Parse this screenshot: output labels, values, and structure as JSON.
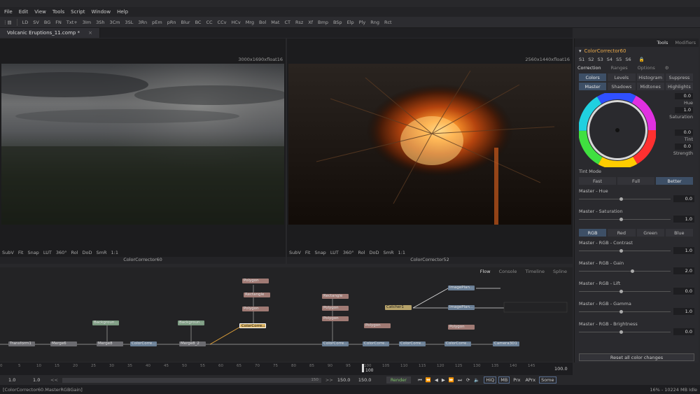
{
  "menu": [
    "File",
    "Edit",
    "View",
    "Tools",
    "Script",
    "Window",
    "Help"
  ],
  "toolbar": [
    "LD",
    "SV",
    "BG",
    "FN",
    "Txt+",
    "3Im",
    "3Sh",
    "3Cm",
    "3SL",
    "3Rn",
    "pEm",
    "pRn",
    "Blur",
    "BC",
    "CC",
    "CCv",
    "HCv",
    "Mrg",
    "Bol",
    "Mat",
    "CT",
    "Rsz",
    "Xf",
    "Bmp",
    "BSp",
    "Elp",
    "Ply",
    "Rng",
    "Rct"
  ],
  "tab": {
    "title": "Volcanic Eruptions_11.comp *",
    "close": "×"
  },
  "viewer_left": {
    "res": "3000x1690xfloat16",
    "label": "ColorCorrector60",
    "tools": [
      "SubV",
      "Fit",
      "Snap",
      "LUT",
      "360°",
      "Rol",
      "DoD",
      "SmR",
      "1:1"
    ]
  },
  "viewer_right": {
    "res": "2560x1440xfloat16",
    "label": "ColorCorrector52",
    "tools": [
      "SubV",
      "Fit",
      "Snap",
      "LUT",
      "360°",
      "Rol",
      "DoD",
      "SmR",
      "1:1"
    ]
  },
  "flow": {
    "tabs": [
      "Flow",
      "Console",
      "Timeline",
      "Spline"
    ],
    "nodes": [
      {
        "label": "Transform1",
        "cls": "n-g"
      },
      {
        "label": "Merge6",
        "cls": "n-g"
      },
      {
        "label": "Backgroun...",
        "cls": "n-grn"
      },
      {
        "label": "Merge8",
        "cls": "n-g"
      },
      {
        "label": "ColorCorre...",
        "cls": "n-b"
      },
      {
        "label": "Backgroun...",
        "cls": "n-grn"
      },
      {
        "label": "Merge8_2",
        "cls": "n-g"
      },
      {
        "label": "ColorCorre...",
        "cls": "n-sel"
      },
      {
        "label": "Polygon",
        "cls": "n-r"
      },
      {
        "label": "Rectangle",
        "cls": "n-r"
      },
      {
        "label": "Polygon",
        "cls": "n-r"
      },
      {
        "label": "Rectangle",
        "cls": "n-r"
      },
      {
        "label": "Polygon",
        "cls": "n-r"
      },
      {
        "label": "Polygon",
        "cls": "n-r"
      },
      {
        "label": "ColorCorre...",
        "cls": "n-b"
      },
      {
        "label": "Polygon",
        "cls": "n-r"
      },
      {
        "label": "ColorCorre...",
        "cls": "n-b"
      },
      {
        "label": "ColorCorre...",
        "cls": "n-b"
      },
      {
        "label": "Catcher1",
        "cls": "n-y"
      },
      {
        "label": "ImagePlan...",
        "cls": "n-b"
      },
      {
        "label": "ImagePlan...",
        "cls": "n-b"
      },
      {
        "label": "Polygon",
        "cls": "n-r"
      },
      {
        "label": "ColorCorre...",
        "cls": "n-b"
      },
      {
        "label": "Camera3D1",
        "cls": "n-b"
      }
    ]
  },
  "timeline": {
    "ticks": [
      "0",
      "5",
      "10",
      "15",
      "20",
      "25",
      "30",
      "35",
      "40",
      "45",
      "50",
      "55",
      "60",
      "65",
      "70",
      "75",
      "80",
      "85",
      "90",
      "95",
      "100",
      "105",
      "110",
      "115",
      "120",
      "125",
      "130",
      "135",
      "140",
      "145"
    ],
    "end_value": "100.0",
    "current": "100"
  },
  "transport": {
    "start": "1.0",
    "in": "1.0",
    "out": "150.0",
    "end": "150.0",
    "range_mark": "150",
    "render": "Render",
    "buttons": [
      "HiQ",
      "MB",
      "Prx",
      "APrx",
      "Some"
    ]
  },
  "status": {
    "left": "[ColorCorrector60.MasterRGBGain]",
    "right": "16% - 10224 MB   Idle"
  },
  "inspector": {
    "top_tabs": [
      "Tools",
      "Modifiers"
    ],
    "tool_name": "ColorCorrector60",
    "versions": [
      "S1",
      "S2",
      "S3",
      "S4",
      "S5",
      "S6"
    ],
    "subtabs": [
      "Correction",
      "Ranges",
      "Options"
    ],
    "mode_tabs": [
      "Colors",
      "Levels",
      "Histogram",
      "Suppress"
    ],
    "range_tabs": [
      "Master",
      "Shadows",
      "Midtones",
      "Highlights"
    ],
    "wheel": {
      "hue": "0.0",
      "hue_label": "Hue",
      "sat": "1.0",
      "sat_label": "Saturation",
      "tint": "0.0",
      "tint_label": "Tint",
      "strength": "0.0",
      "strength_label": "Strength"
    },
    "tint_mode": {
      "label": "Tint Mode",
      "options": [
        "Fast",
        "Full",
        "Better"
      ],
      "selected": "Better"
    },
    "master_sliders": [
      {
        "label": "Master - Hue",
        "value": "0.0"
      },
      {
        "label": "Master - Saturation",
        "value": "1.0"
      }
    ],
    "channel_tabs": [
      "RGB",
      "Red",
      "Green",
      "Blue"
    ],
    "rgb_sliders": [
      {
        "label": "Master - RGB - Contrast",
        "value": "1.0"
      },
      {
        "label": "Master - RGB - Gain",
        "value": "2.0"
      },
      {
        "label": "Master - RGB - Lift",
        "value": "0.0"
      },
      {
        "label": "Master - RGB - Gamma",
        "value": "1.0"
      },
      {
        "label": "Master - RGB - Brightness",
        "value": "0.0"
      }
    ],
    "reset": "Reset all color changes",
    "accent": "#3d4f66"
  }
}
